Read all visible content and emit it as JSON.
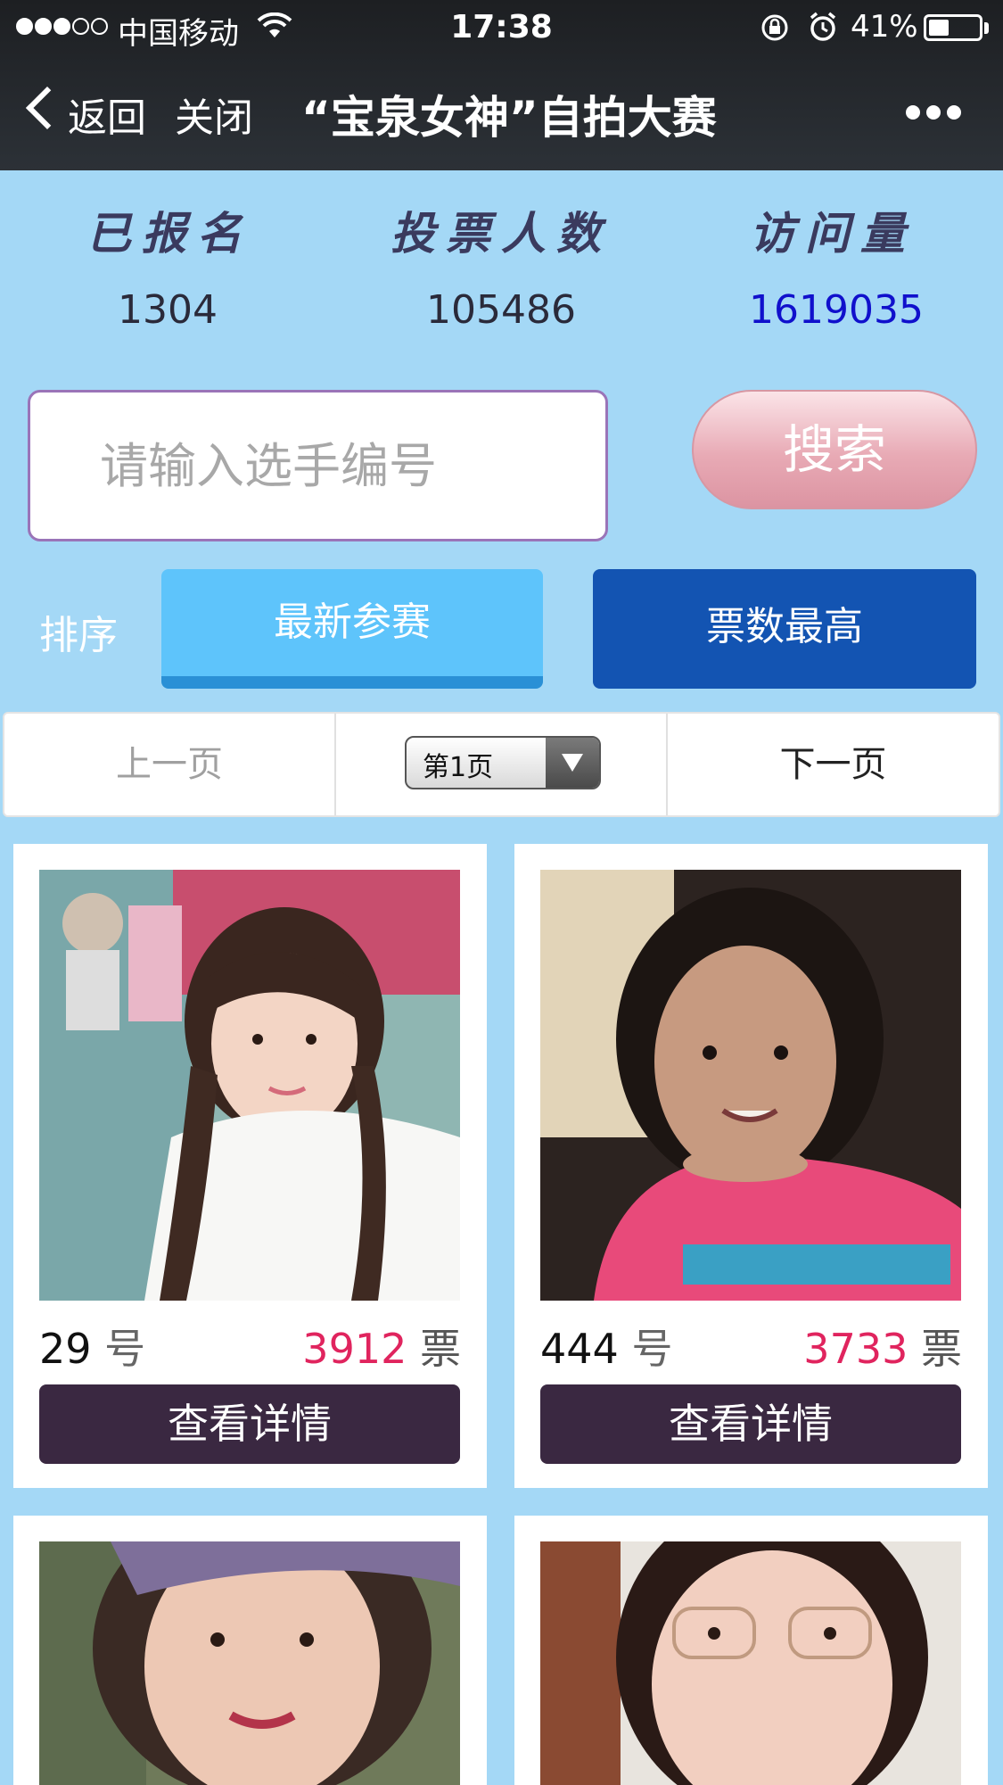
{
  "status": {
    "carrier": "中国移动",
    "time": "17:38",
    "battery": "41%",
    "battery_level": 0.41
  },
  "nav": {
    "back": "返回",
    "close": "关闭",
    "title": "“宝泉女神”自拍大赛"
  },
  "stats": [
    {
      "label": "已报名",
      "value": "1304",
      "color": "#2a2a3a"
    },
    {
      "label": "投票人数",
      "value": "105486",
      "color": "#2a2a3a"
    },
    {
      "label": "访问量",
      "value": "1619035",
      "color": "#1010cc"
    }
  ],
  "search": {
    "placeholder": "请输入选手编号",
    "button": "搜索"
  },
  "sort": {
    "label": "排序",
    "newest": "最新参赛",
    "top_votes": "票数最高"
  },
  "pager": {
    "prev": "上一页",
    "current": "第1页",
    "next": "下一页"
  },
  "contestants": [
    {
      "number": "29",
      "number_unit": "号",
      "votes": "3912",
      "votes_unit": "票",
      "detail": "查看详情"
    },
    {
      "number": "444",
      "number_unit": "号",
      "votes": "3733",
      "votes_unit": "票",
      "detail": "查看详情"
    },
    {
      "number": "",
      "number_unit": "",
      "votes": "",
      "votes_unit": "",
      "detail": ""
    },
    {
      "number": "",
      "number_unit": "",
      "votes": "",
      "votes_unit": "",
      "detail": ""
    }
  ],
  "colors": {
    "background": "#a4d8f6",
    "vote_count": "#e0245e",
    "detail_button": "#3a2841",
    "sort_active": "#1354b2"
  }
}
